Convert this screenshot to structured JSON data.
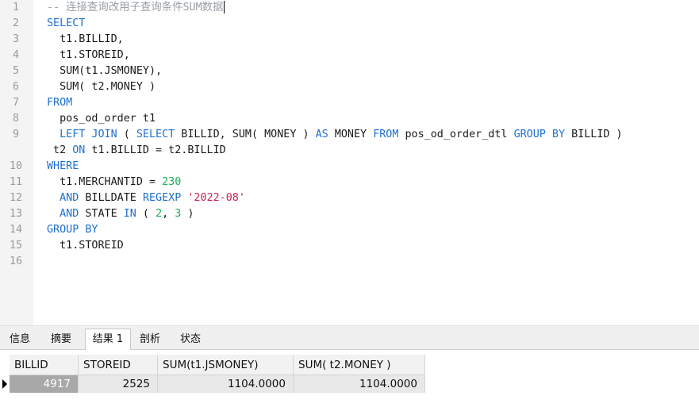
{
  "editor": {
    "lines": [
      {
        "n": "1",
        "tokens": [
          {
            "t": "cmt",
            "v": "-- 连接查询改用子查询条件SUM数据"
          }
        ],
        "cursor": true
      },
      {
        "n": "2",
        "tokens": [
          {
            "t": "kw",
            "v": "SELECT"
          }
        ]
      },
      {
        "n": "3",
        "tokens": [
          {
            "t": "plain",
            "v": "  t1.BILLID,"
          }
        ]
      },
      {
        "n": "4",
        "tokens": [
          {
            "t": "plain",
            "v": "  t1.STOREID,"
          }
        ]
      },
      {
        "n": "5",
        "tokens": [
          {
            "t": "plain",
            "v": "  SUM(t1.JSMONEY),"
          }
        ]
      },
      {
        "n": "6",
        "tokens": [
          {
            "t": "plain",
            "v": "  SUM( t2.MONEY )"
          }
        ]
      },
      {
        "n": "7",
        "tokens": [
          {
            "t": "kw",
            "v": "FROM"
          }
        ]
      },
      {
        "n": "8",
        "tokens": [
          {
            "t": "plain",
            "v": "  pos_od_order t1"
          }
        ]
      },
      {
        "n": "9",
        "tokens": [
          {
            "t": "plain",
            "v": "  "
          },
          {
            "t": "kw",
            "v": "LEFT JOIN"
          },
          {
            "t": "plain",
            "v": " ( "
          },
          {
            "t": "kw",
            "v": "SELECT"
          },
          {
            "t": "plain",
            "v": " BILLID, SUM( MONEY ) "
          },
          {
            "t": "kw",
            "v": "AS"
          },
          {
            "t": "plain",
            "v": " MONEY "
          },
          {
            "t": "kw",
            "v": "FROM"
          },
          {
            "t": "plain",
            "v": " pos_od_order_dtl "
          },
          {
            "t": "kw",
            "v": "GROUP BY"
          },
          {
            "t": "plain",
            "v": " BILLID )"
          }
        ]
      },
      {
        "n": "",
        "tokens": [
          {
            "t": "plain",
            "v": " t2 "
          },
          {
            "t": "kw",
            "v": "ON"
          },
          {
            "t": "plain",
            "v": " t1.BILLID = t2.BILLID"
          }
        ]
      },
      {
        "n": "10",
        "tokens": [
          {
            "t": "kw",
            "v": "WHERE"
          }
        ]
      },
      {
        "n": "11",
        "tokens": [
          {
            "t": "plain",
            "v": "  t1.MERCHANTID = "
          },
          {
            "t": "num",
            "v": "230"
          }
        ]
      },
      {
        "n": "12",
        "tokens": [
          {
            "t": "plain",
            "v": "  "
          },
          {
            "t": "kw",
            "v": "AND"
          },
          {
            "t": "plain",
            "v": " BILLDATE "
          },
          {
            "t": "kw",
            "v": "REGEXP"
          },
          {
            "t": "plain",
            "v": " "
          },
          {
            "t": "str",
            "v": "'2022-08'"
          }
        ]
      },
      {
        "n": "13",
        "tokens": [
          {
            "t": "plain",
            "v": "  "
          },
          {
            "t": "kw",
            "v": "AND"
          },
          {
            "t": "plain",
            "v": " STATE "
          },
          {
            "t": "kw",
            "v": "IN"
          },
          {
            "t": "plain",
            "v": " ( "
          },
          {
            "t": "num",
            "v": "2"
          },
          {
            "t": "plain",
            "v": ", "
          },
          {
            "t": "num",
            "v": "3"
          },
          {
            "t": "plain",
            "v": " )"
          }
        ]
      },
      {
        "n": "14",
        "tokens": [
          {
            "t": "kw",
            "v": "GROUP BY"
          }
        ]
      },
      {
        "n": "15",
        "tokens": [
          {
            "t": "plain",
            "v": "  t1.STOREID"
          }
        ]
      },
      {
        "n": "16",
        "tokens": []
      }
    ]
  },
  "tabs": [
    {
      "label": "信息",
      "active": false
    },
    {
      "label": "摘要",
      "active": false
    },
    {
      "label": "结果 1",
      "active": true
    },
    {
      "label": "剖析",
      "active": false
    },
    {
      "label": "状态",
      "active": false
    }
  ],
  "result": {
    "columns": [
      "BILLID",
      "STOREID",
      "SUM(t1.JSMONEY)",
      "SUM( t2.MONEY )"
    ],
    "rows": [
      [
        "4917",
        "2525",
        "1104.0000",
        "1104.0000"
      ]
    ]
  },
  "colors": {
    "keyword": "#1f6fd0",
    "number": "#17b24f",
    "string": "#c7254e",
    "comment": "#9aa0a6"
  }
}
